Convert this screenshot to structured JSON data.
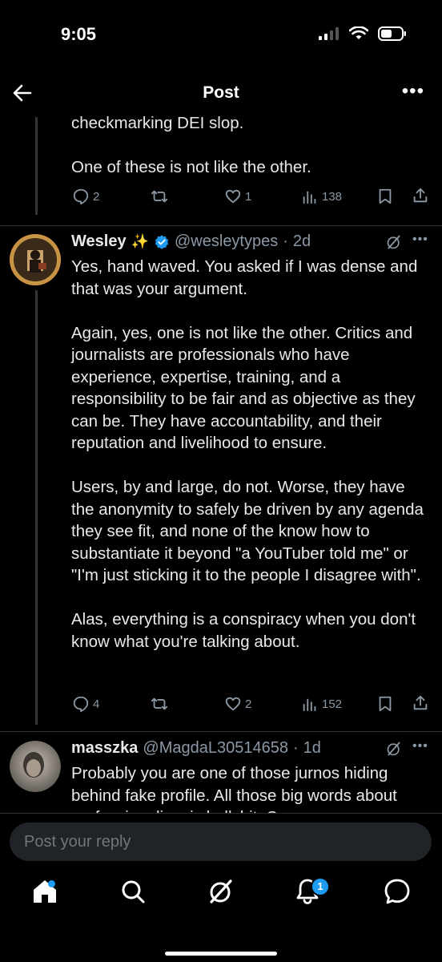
{
  "status": {
    "time": "9:05"
  },
  "header": {
    "title": "Post"
  },
  "prev_tweet": {
    "text": "checkmarking DEI slop.\n\nOne of these is not like the other.",
    "replies": "2",
    "retweets": "",
    "likes": "1",
    "views": "138"
  },
  "tweet": {
    "name": "Wesley",
    "sparkle": "✨",
    "handle": "@wesleytypes",
    "time": "2d",
    "text": "Yes, hand waved. You asked if I was dense and that was your argument.\n\nAgain, yes, one is not like the other. Critics and journalists are professionals who have experience, expertise, training, and a responsibility to be fair and as objective as they can be. They have accountability, and their reputation and livelihood to ensure.\n\nUsers, by and large, do not. Worse, they have the anonymity to safely be driven by any agenda they see fit, and none of the know how to substantiate it beyond \"a YouTuber told me\" or \"I'm just sticking it to the people I disagree with\".\n\nAlas, everything is a conspiracy when you don't know what you're talking about.",
    "replies": "4",
    "likes": "2",
    "views": "152"
  },
  "reply": {
    "name": "masszka",
    "handle": "@MagdaL30514658",
    "time": "1d",
    "text": "Probably you are one of those jurnos hiding behind fake profile. All those big words about professionalism is bullshit. So..."
  },
  "compose": {
    "placeholder": "Post your reply"
  },
  "tabs": {
    "notifications_count": "1"
  },
  "colors": {
    "accent": "#1d9bf0",
    "background": "#000000",
    "muted": "#8b98a5"
  }
}
